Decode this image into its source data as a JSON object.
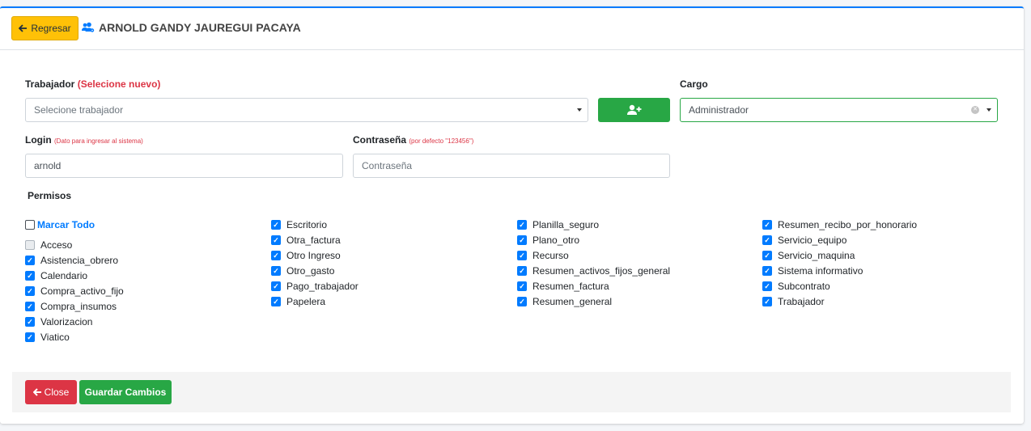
{
  "header": {
    "back_label": "Regresar",
    "title": "ARNOLD GANDY JAUREGUI PACAYA"
  },
  "form": {
    "trabajador_label": "Trabajador",
    "trabajador_hint": "(Selecione nuevo)",
    "trabajador_placeholder": "Selecione trabajador",
    "cargo_label": "Cargo",
    "cargo_value": "Administrador",
    "login_label": "Login",
    "login_hint": "(Dato para ingresar al sistema)",
    "login_value": "arnold",
    "password_label": "Contraseña",
    "password_hint": "(por defecto \"123456\")",
    "password_placeholder": "Contraseña",
    "permisos_label": "Permisos",
    "marcar_todo": "Marcar Todo"
  },
  "permissions": {
    "col1": [
      {
        "label": "Acceso",
        "checked": false
      },
      {
        "label": "Asistencia_obrero",
        "checked": true
      },
      {
        "label": "Calendario",
        "checked": true
      },
      {
        "label": "Compra_activo_fijo",
        "checked": true
      },
      {
        "label": "Compra_insumos",
        "checked": true
      },
      {
        "label": "Valorizacion",
        "checked": true
      },
      {
        "label": "Viatico",
        "checked": true
      }
    ],
    "col2": [
      {
        "label": "Escritorio",
        "checked": true
      },
      {
        "label": "Otra_factura",
        "checked": true
      },
      {
        "label": "Otro Ingreso",
        "checked": true
      },
      {
        "label": "Otro_gasto",
        "checked": true
      },
      {
        "label": "Pago_trabajador",
        "checked": true
      },
      {
        "label": "Papelera",
        "checked": true
      }
    ],
    "col3": [
      {
        "label": "Planilla_seguro",
        "checked": true
      },
      {
        "label": "Plano_otro",
        "checked": true
      },
      {
        "label": "Recurso",
        "checked": true
      },
      {
        "label": "Resumen_activos_fijos_general",
        "checked": true
      },
      {
        "label": "Resumen_factura",
        "checked": true
      },
      {
        "label": "Resumen_general",
        "checked": true
      }
    ],
    "col4": [
      {
        "label": "Resumen_recibo_por_honorario",
        "checked": true
      },
      {
        "label": "Servicio_equipo",
        "checked": true
      },
      {
        "label": "Servicio_maquina",
        "checked": true
      },
      {
        "label": "Sistema informativo",
        "checked": true
      },
      {
        "label": "Subcontrato",
        "checked": true
      },
      {
        "label": "Trabajador",
        "checked": true
      }
    ]
  },
  "footer": {
    "close_label": "Close",
    "save_label": "Guardar Cambios"
  },
  "colors": {
    "primary": "#007bff",
    "success": "#28a745",
    "danger": "#dc3545",
    "warning": "#ffc107"
  }
}
